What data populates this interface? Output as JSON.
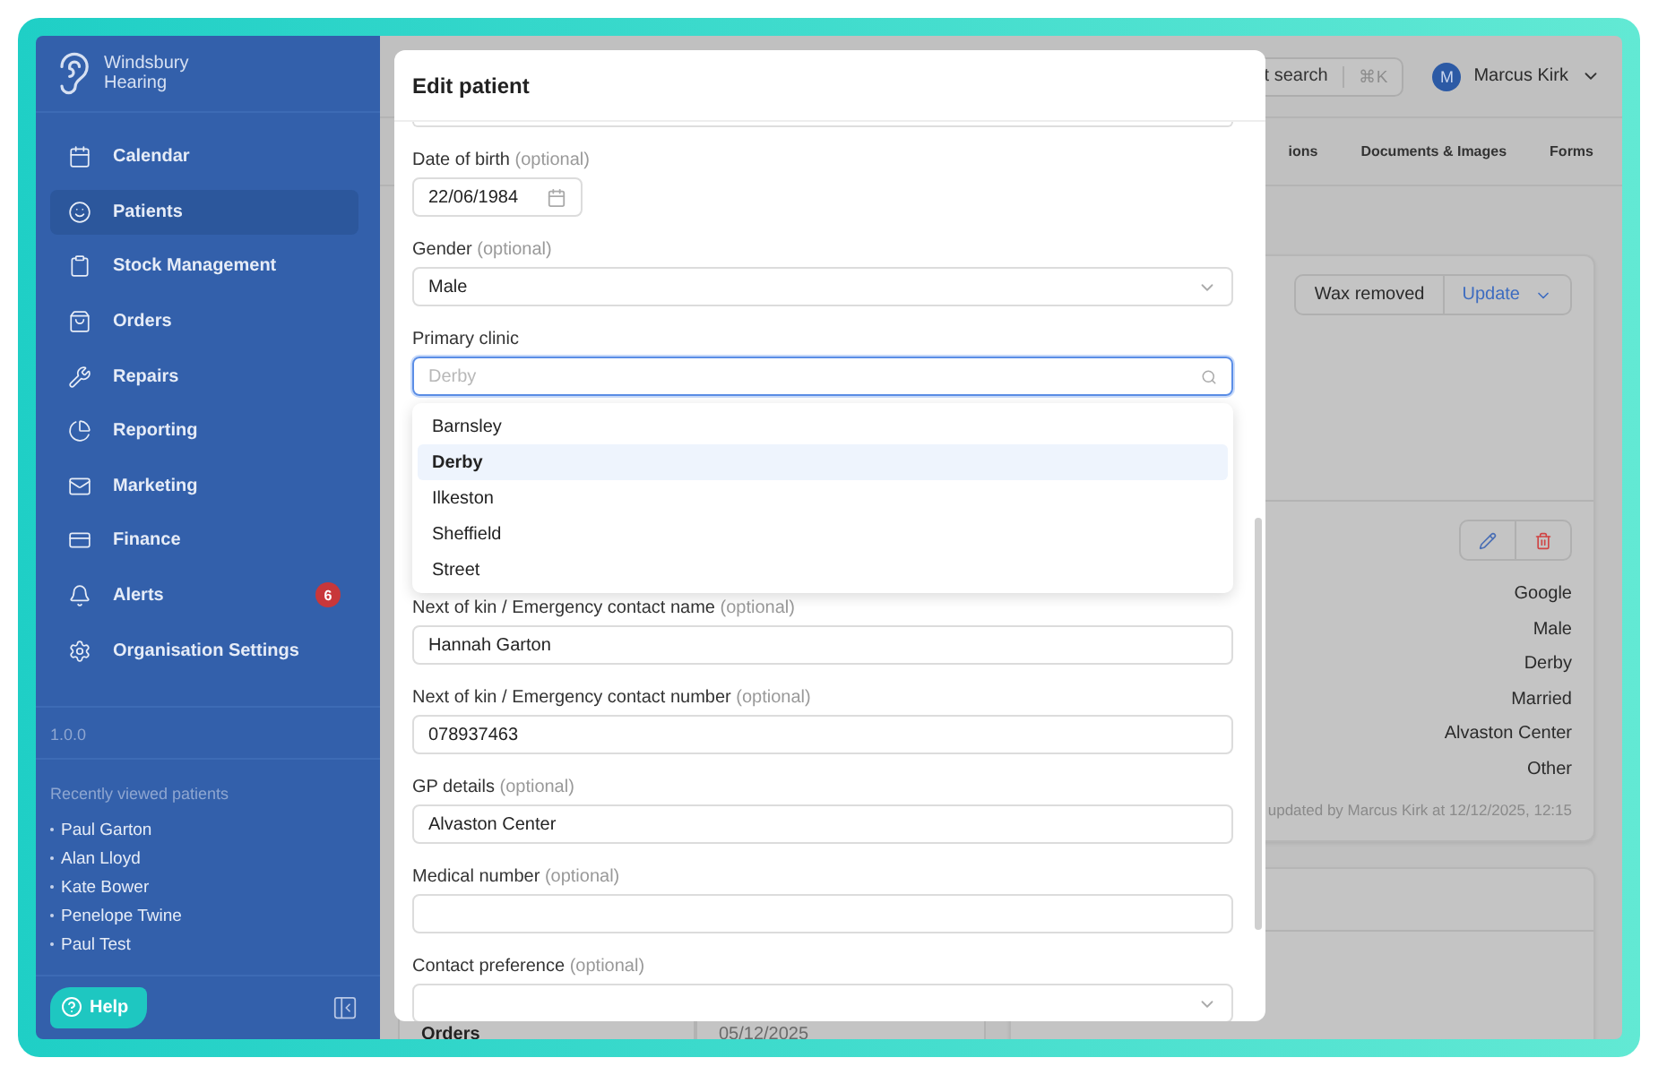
{
  "sidebar": {
    "brand": "Windsbury Hearing",
    "nav": [
      {
        "label": "Calendar",
        "selected": false
      },
      {
        "label": "Patients",
        "selected": true
      },
      {
        "label": "Stock Management",
        "selected": false
      },
      {
        "label": "Orders",
        "selected": false
      },
      {
        "label": "Repairs",
        "selected": false
      },
      {
        "label": "Reporting",
        "selected": false
      },
      {
        "label": "Marketing",
        "selected": false
      },
      {
        "label": "Finance",
        "selected": false
      },
      {
        "label": "Alerts",
        "selected": false,
        "badge": "6"
      },
      {
        "label": "Organisation Settings",
        "selected": false
      }
    ],
    "version": "1.0.0",
    "recent_title": "Recently viewed patients",
    "recent_patients": [
      "Paul Garton",
      "Alan Lloyd",
      "Kate Bower",
      "Penelope Twine",
      "Paul Test"
    ],
    "help_button": "Help"
  },
  "header": {
    "search_button": "t search",
    "shortcut": "⌘K",
    "avatar_initial": "M",
    "user_name": "Marcus Kirk"
  },
  "tabs": [
    "ions",
    "Documents & Images",
    "Forms"
  ],
  "status_card": {
    "status": "Wax removed",
    "action": "Update",
    "details": [
      "Google",
      "Male",
      "Derby",
      "Married",
      "Alvaston Center",
      "Other"
    ],
    "footer": "updated by Marcus Kirk at 12/12/2025, 12:15"
  },
  "orders_row": {
    "label": "Orders",
    "date": "05/12/2025"
  },
  "modal": {
    "title": "Edit patient",
    "fields": [
      {
        "kind": "date",
        "label": "Date of birth",
        "note": "(optional)",
        "value": "22/06/1984"
      },
      {
        "kind": "select",
        "label": "Gender",
        "note": "(optional)",
        "value": "Male"
      },
      {
        "kind": "search",
        "label": "Primary clinic",
        "placeholder": "Derby",
        "focused": true
      },
      {
        "kind": "text",
        "label": "Next of kin / Emergency contact name",
        "note": "(optional)",
        "value": "Hannah Garton"
      },
      {
        "kind": "text",
        "label": "Next of kin / Emergency contact number",
        "note": "(optional)",
        "value": "078937463"
      },
      {
        "kind": "text",
        "label": "GP details",
        "note": "(optional)",
        "value": "Alvaston Center"
      },
      {
        "kind": "text",
        "label": "Medical number",
        "note": "(optional)"
      },
      {
        "kind": "select",
        "label": "Contact preference",
        "note": "(optional)"
      }
    ],
    "dropdown": [
      {
        "label": "Barnsley",
        "selected": false
      },
      {
        "label": "Derby",
        "selected": true
      },
      {
        "label": "Ilkeston",
        "selected": false
      },
      {
        "label": "Sheffield",
        "selected": false
      },
      {
        "label": "Street",
        "selected": false
      }
    ]
  }
}
